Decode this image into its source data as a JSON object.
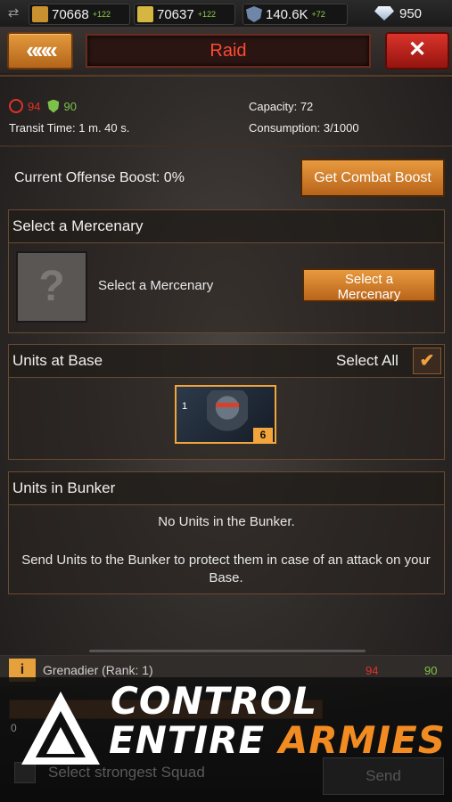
{
  "resources": [
    {
      "icon": "metal-icon",
      "value": "70668",
      "gain": "+122",
      "color": "#c8912f"
    },
    {
      "icon": "fuel-icon",
      "value": "70637",
      "gain": "+122",
      "color": "#d4b640"
    },
    {
      "icon": "shield-resource-icon",
      "value": "140.6K",
      "gain": "+72",
      "color": "#6f86a8"
    }
  ],
  "diamonds": {
    "icon": "diamond-icon",
    "value": "950"
  },
  "header": {
    "back_label": "«««",
    "title": "Raid",
    "close_label": "✕"
  },
  "stats": {
    "attack_value": "94",
    "defense_value": "90",
    "transit_label": "Transit Time:",
    "transit_value": "1 m. 40 s.",
    "capacity_label": "Capacity:",
    "capacity_value": "72",
    "consumption_label": "Consumption:",
    "consumption_value": "3/1000"
  },
  "boost": {
    "label": "Current Offense Boost:",
    "value": "0%",
    "button": "Get Combat Boost"
  },
  "mercenary": {
    "header": "Select a Mercenary",
    "placeholder_mark": "?",
    "label": "Select a Mercenary",
    "button_line1": "Select a",
    "button_line2": "Mercenary"
  },
  "units_base": {
    "header": "Units at Base",
    "select_all": "Select All",
    "check": "✔",
    "unit": {
      "level": "1",
      "count": "6"
    }
  },
  "bunker": {
    "header": "Units in Bunker",
    "empty": "No Units in the Bunker.",
    "hint": "Send Units to the Bunker to protect them in case of an attack on your Base."
  },
  "squad": {
    "name": "Grenadier (Rank: 1)",
    "attack": "94",
    "defense": "90",
    "slider_min": "0",
    "send": "Send",
    "strongest": "Select strongest Squad"
  },
  "promo": {
    "line1": "CONTROL",
    "line2a": "ENTIRE",
    "line2b": "ARMIES"
  },
  "colors": {
    "accent_orange": "#f28c22",
    "danger_red": "#ff4a35",
    "attack_red": "#e2312a",
    "defense_green": "#7cc24a"
  }
}
